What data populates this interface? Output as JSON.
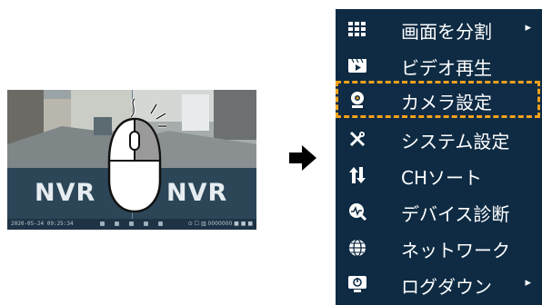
{
  "preview": {
    "left_logo": "NVR",
    "right_logo": "NVR",
    "clock": "2020-05-24 09:25:34",
    "right_info": "⊙ ☐ ▥ 0000000 ■ ■ ■"
  },
  "colors": {
    "menu_bg": "#0e2b43",
    "highlight": "#f3a21a",
    "preview_bg": "#2c4658"
  },
  "menu": {
    "items": [
      {
        "label": "画面を分割",
        "icon": "grid-icon",
        "submenu": "▸"
      },
      {
        "label": "ビデオ再生",
        "icon": "video-playback-icon",
        "submenu": ""
      },
      {
        "label": "カメラ設定",
        "icon": "camera-icon",
        "submenu": ""
      },
      {
        "label": "システム設定",
        "icon": "tools-icon",
        "submenu": ""
      },
      {
        "label": "CHソート",
        "icon": "sort-icon",
        "submenu": ""
      },
      {
        "label": "デバイス診断",
        "icon": "diagnose-icon",
        "submenu": ""
      },
      {
        "label": "ネットワーク",
        "icon": "globe-icon",
        "submenu": ""
      },
      {
        "label": "ログダウン",
        "icon": "logout-icon",
        "submenu": "▸"
      }
    ]
  }
}
